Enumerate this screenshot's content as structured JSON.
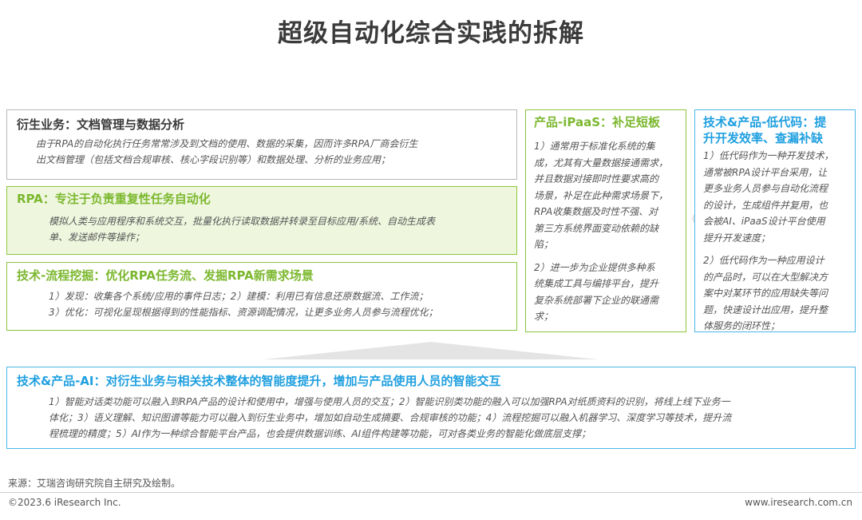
{
  "title": "超级自动化综合实践的拆解",
  "box_derivative": {
    "heading": "衍生业务：文档管理与数据分析",
    "line1": "由于RPA的自动化执行任务常常涉及到文档的使用、数据的采集，因而许多RPA厂商会衍生",
    "line2": "出文档管理（包括文档合规审核、核心字段识别等）和数据处理、分析的业务应用；"
  },
  "box_rpa": {
    "heading": "RPA：专注于负责重复性任务自动化",
    "line1": "模拟人类与应用程序和系统交互，批量化执行读取数据并转录至目标应用/系统、自动生成表",
    "line2": "单、发送邮件等操作；"
  },
  "box_mining": {
    "heading": "技术-流程挖掘：优化RPA任务流、发掘RPA新需求场景",
    "line1": "1）发现：收集各个系统/应用的事件日志；2）建模：利用已有信息还原数据流、工作流；",
    "line2": "3）优化：可视化呈现根据得到的性能指标、资源调配情况，让更多业务人员参与流程优化；"
  },
  "box_ipaas": {
    "heading": "产品-iPaaS：补足短板",
    "lines": [
      "1）通常用于标准化系统的集",
      "成，尤其有大量数据接通需求，",
      "并且数据对接即时性要求高的",
      "场景，补足在此种需求场景下，",
      "RPA收集数据及时性不强、对",
      "第三方系统界面变动依赖的缺",
      "陷；",
      "",
      "2）进一步为企业提供多种系",
      "统集成工具与编排平台，提升",
      "复杂系统部署下企业的联通需",
      "求；"
    ]
  },
  "box_lowcode": {
    "heading1": "技术&产品-低代码：提",
    "heading2": "升开发效率、查漏补缺",
    "lines": [
      "1）低代码作为一种开发技术，",
      "通常被RPA设计平台采用，让",
      "更多业务人员参与自动化流程",
      "的设计，生成组件并复用，也",
      "会被AI、iPaaS设计平台使用",
      "提升开发速度；",
      "",
      "2）低代码作为一种应用设计",
      "的产品时，可以在大型解决方",
      "案中对某环节的应用缺失等问",
      "题，快速设计出应用，提升整",
      "体服务的闭环性；"
    ]
  },
  "box_ai": {
    "heading": "技术&产品-AI：对衍生业务与相关技术整体的智能度提升，增加与产品使用人员的智能交互",
    "line1": "1）智能对话类功能可以融入到RPA产品的设计和使用中，增强与使用人员的交互；2）智能识别类功能的融入可以加强RPA对纸质资料的识别，将线上线下业务一",
    "line2": "体化；3）语义理解、知识图谱等能力可以融入到衍生业务中，增加如自动生成摘要、合规审核的功能；4）流程挖掘可以融入机器学习、深度学习等技术，提升流",
    "line3": "程梳理的精度；5）AI作为一种综合智能平台产品，也会提供数据训练、AI组件构建等功能，可对各类业务的智能化做底层支撑；"
  },
  "chevron_glyph": "《",
  "footer": {
    "source": "来源：艾瑞咨询研究院自主研究及绘制。",
    "copyright": "©2023.6 iResearch Inc.",
    "website": "www.iresearch.com.cn"
  },
  "colors": {
    "green": "#8cc63e",
    "blue": "#4ab8e8",
    "gray": "#b8b8b8"
  }
}
